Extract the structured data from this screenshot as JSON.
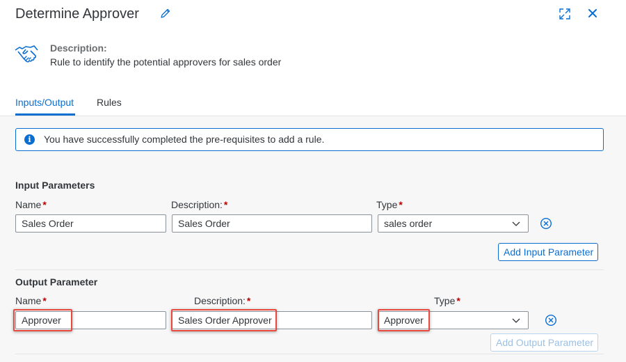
{
  "header": {
    "title": "Determine Approver",
    "edit_icon": "pencil-icon",
    "expand_icon": "expand-icon",
    "close_icon": "close-icon"
  },
  "description": {
    "icon": "handshake-icon",
    "label": "Description:",
    "text": "Rule to identify the potential approvers for sales order"
  },
  "tabs": [
    {
      "label": "Inputs/Output",
      "selected": true
    },
    {
      "label": "Rules",
      "selected": false
    }
  ],
  "info": {
    "icon": "info-icon",
    "message": "You have successfully completed the pre-requisites to add a rule."
  },
  "input_parameters": {
    "title": "Input Parameters",
    "name_label": "Name",
    "description_label": "Description:",
    "type_label": "Type",
    "required_marker": "*",
    "name_value": "Sales Order",
    "description_value": "Sales Order",
    "type_value": "sales order",
    "add_button": "Add Input Parameter"
  },
  "output_parameter": {
    "title": "Output Parameter",
    "name_label": "Name",
    "description_label": "Description:",
    "type_label": "Type",
    "required_marker": "*",
    "name_value": "Approver",
    "description_value": "Sales Order Approver",
    "type_value": "Approver",
    "add_button": "Add Output Parameter"
  },
  "colors": {
    "accent": "#0a6ed1",
    "required": "#bb0000",
    "highlight": "#e9483d"
  }
}
